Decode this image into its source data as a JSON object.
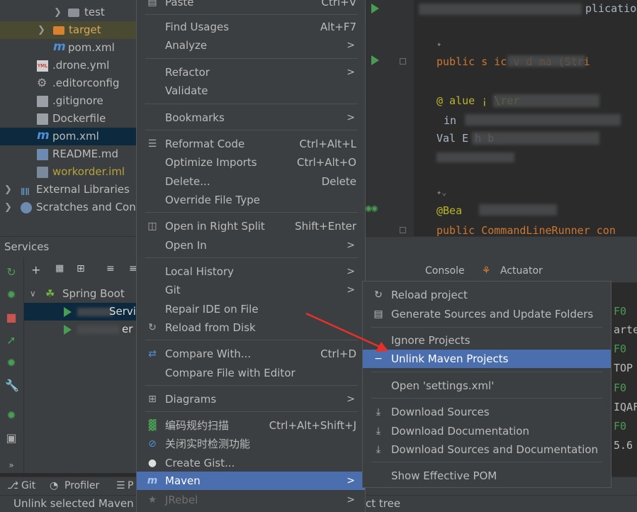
{
  "project_tree": {
    "items": [
      {
        "label": "test"
      },
      {
        "label": "target"
      },
      {
        "label": "pom.xml"
      },
      {
        "label": ".drone.yml"
      },
      {
        "label": ".editorconfig"
      },
      {
        "label": ".gitignore"
      },
      {
        "label": "Dockerfile"
      },
      {
        "label": "pom.xml"
      },
      {
        "label": "README.md"
      },
      {
        "label": "workorder.iml"
      },
      {
        "label": "External Libraries"
      },
      {
        "label": "Scratches and Cons"
      }
    ]
  },
  "editor": {
    "lines": [
      "plication",
      "public s   ic v   d  ma  (Stri",
      "@ alue        ¡   \\rer",
      "  in",
      "Val              E     h  b",
      "@Bea",
      "public CommandLineRunner con"
    ]
  },
  "services": {
    "title": "Services",
    "tree": [
      {
        "label": "Spring Boot"
      },
      {
        "label": "Servi"
      },
      {
        "label": "er"
      }
    ],
    "console_tab": "Console",
    "actuator_tab": "Actuator",
    "console_lines": [
      "F0",
      "arte",
      "F0",
      "TOP",
      "F0",
      "IQAF",
      "F0",
      "5.6"
    ]
  },
  "bottom_toolbar": {
    "git": "Git",
    "profiler": "Profiler",
    "p": "P"
  },
  "status_bar": {
    "left": "Unlink selected Maven p",
    "right": "ct tree"
  },
  "context_menu": {
    "items": [
      {
        "label": "Paste",
        "shortcut": "Ctrl+V"
      },
      {
        "label": "Find Usages",
        "shortcut": "Alt+F7"
      },
      {
        "label": "Analyze",
        "submenu": ">"
      },
      {
        "label": "Refactor",
        "submenu": ">"
      },
      {
        "label": "Validate"
      },
      {
        "label": "Bookmarks",
        "submenu": ">"
      },
      {
        "label": "Reformat Code",
        "shortcut": "Ctrl+Alt+L"
      },
      {
        "label": "Optimize Imports",
        "shortcut": "Ctrl+Alt+O"
      },
      {
        "label": "Delete...",
        "shortcut": "Delete"
      },
      {
        "label": "Override File Type"
      },
      {
        "label": "Open in Right Split",
        "shortcut": "Shift+Enter"
      },
      {
        "label": "Open In",
        "submenu": ">"
      },
      {
        "label": "Local History",
        "submenu": ">"
      },
      {
        "label": "Git",
        "submenu": ">"
      },
      {
        "label": "Repair IDE on File"
      },
      {
        "label": "Reload from Disk"
      },
      {
        "label": "Compare With...",
        "shortcut": "Ctrl+D"
      },
      {
        "label": "Compare File with Editor"
      },
      {
        "label": "Diagrams",
        "submenu": ">"
      },
      {
        "label": "编码规约扫描",
        "shortcut": "Ctrl+Alt+Shift+J"
      },
      {
        "label": "关闭实时检测功能"
      },
      {
        "label": "Create Gist..."
      },
      {
        "label": "Maven",
        "submenu": ">"
      },
      {
        "label": "JRebel",
        "submenu": ">"
      }
    ]
  },
  "maven_submenu": {
    "items": [
      {
        "label": "Reload project"
      },
      {
        "label": "Generate Sources and Update Folders"
      },
      {
        "label": "Ignore Projects"
      },
      {
        "label": "Unlink Maven Projects"
      },
      {
        "label": "Open 'settings.xml'"
      },
      {
        "label": "Download Sources"
      },
      {
        "label": "Download Documentation"
      },
      {
        "label": "Download Sources and Documentation"
      },
      {
        "label": "Show Effective POM"
      }
    ]
  },
  "colors": {
    "selection": "#4b6eaf",
    "annotation_arrow": "#e8302a",
    "run_green": "#499c54",
    "keyword": "#cc7832"
  }
}
